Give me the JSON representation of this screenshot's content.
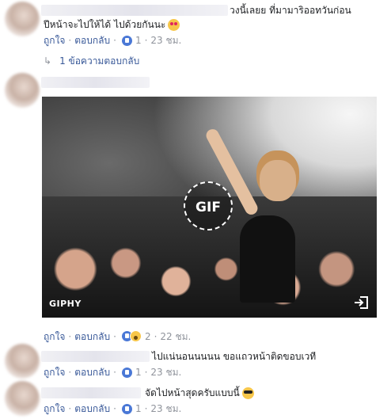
{
  "comments": [
    {
      "text": "วงนี้เลยย ที่มามาริออทวันก่อน",
      "text2": "ปีหน้าจะไปให้ได้ ไปด้วยกันนะ",
      "emoji": "heart-eyes-emoji",
      "like_label": "ถูกใจ",
      "reply_label": "ตอบกลับ",
      "reaction_count": "1",
      "time": "23 ชม."
    },
    {
      "gif_badge": "GIF",
      "gif_watermark": "GIPHY",
      "like_label": "ถูกใจ",
      "reply_label": "ตอบกลับ",
      "reaction_count": "2",
      "time": "22 ชม."
    },
    {
      "text": "ไปแน่นอนนนนน ขอแถวหน้าติดขอบเวที",
      "like_label": "ถูกใจ",
      "reply_label": "ตอบกลับ",
      "reaction_count": "1",
      "time": "23 ชม."
    },
    {
      "text": "จัดไปหน้าสุดครับแบบนี้",
      "emoji": "sunglasses-emoji",
      "like_label": "ถูกใจ",
      "reply_label": "ตอบกลับ",
      "reaction_count": "1",
      "time": "23 ชม."
    }
  ],
  "replies_link": "1 ข้อความตอบกลับ",
  "colors": {
    "link": "#385898",
    "meta": "#90949c",
    "like_blue": "#4a78d6"
  }
}
